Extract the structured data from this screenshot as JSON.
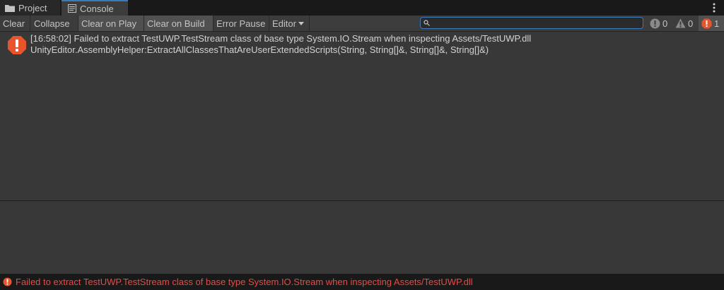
{
  "tabs": {
    "project": {
      "label": "Project",
      "icon": "folder-icon"
    },
    "console": {
      "label": "Console",
      "icon": "console-icon"
    }
  },
  "toolbar": {
    "clear": "Clear",
    "collapse": "Collapse",
    "clear_on_play": "Clear on Play",
    "clear_on_build": "Clear on Build",
    "error_pause": "Error Pause",
    "editor": "Editor",
    "search_value": "",
    "counts": {
      "log": "0",
      "warning": "0",
      "error": "1"
    }
  },
  "log_entries": [
    {
      "type": "error",
      "line1": "[16:58:02] Failed to extract TestUWP.TestStream class of base type System.IO.Stream when inspecting Assets/TestUWP.dll",
      "line2": "UnityEditor.AssemblyHelper:ExtractAllClassesThatAreUserExtendedScripts(String, String[]&, String[]&, String[]&)"
    }
  ],
  "status_bar": {
    "text": "Failed to extract TestUWP.TestStream class of base type System.IO.Stream when inspecting Assets/TestUWP.dll"
  },
  "colors": {
    "accent": "#3a79bb",
    "error": "#e8552d",
    "error_text": "#e84a45"
  }
}
